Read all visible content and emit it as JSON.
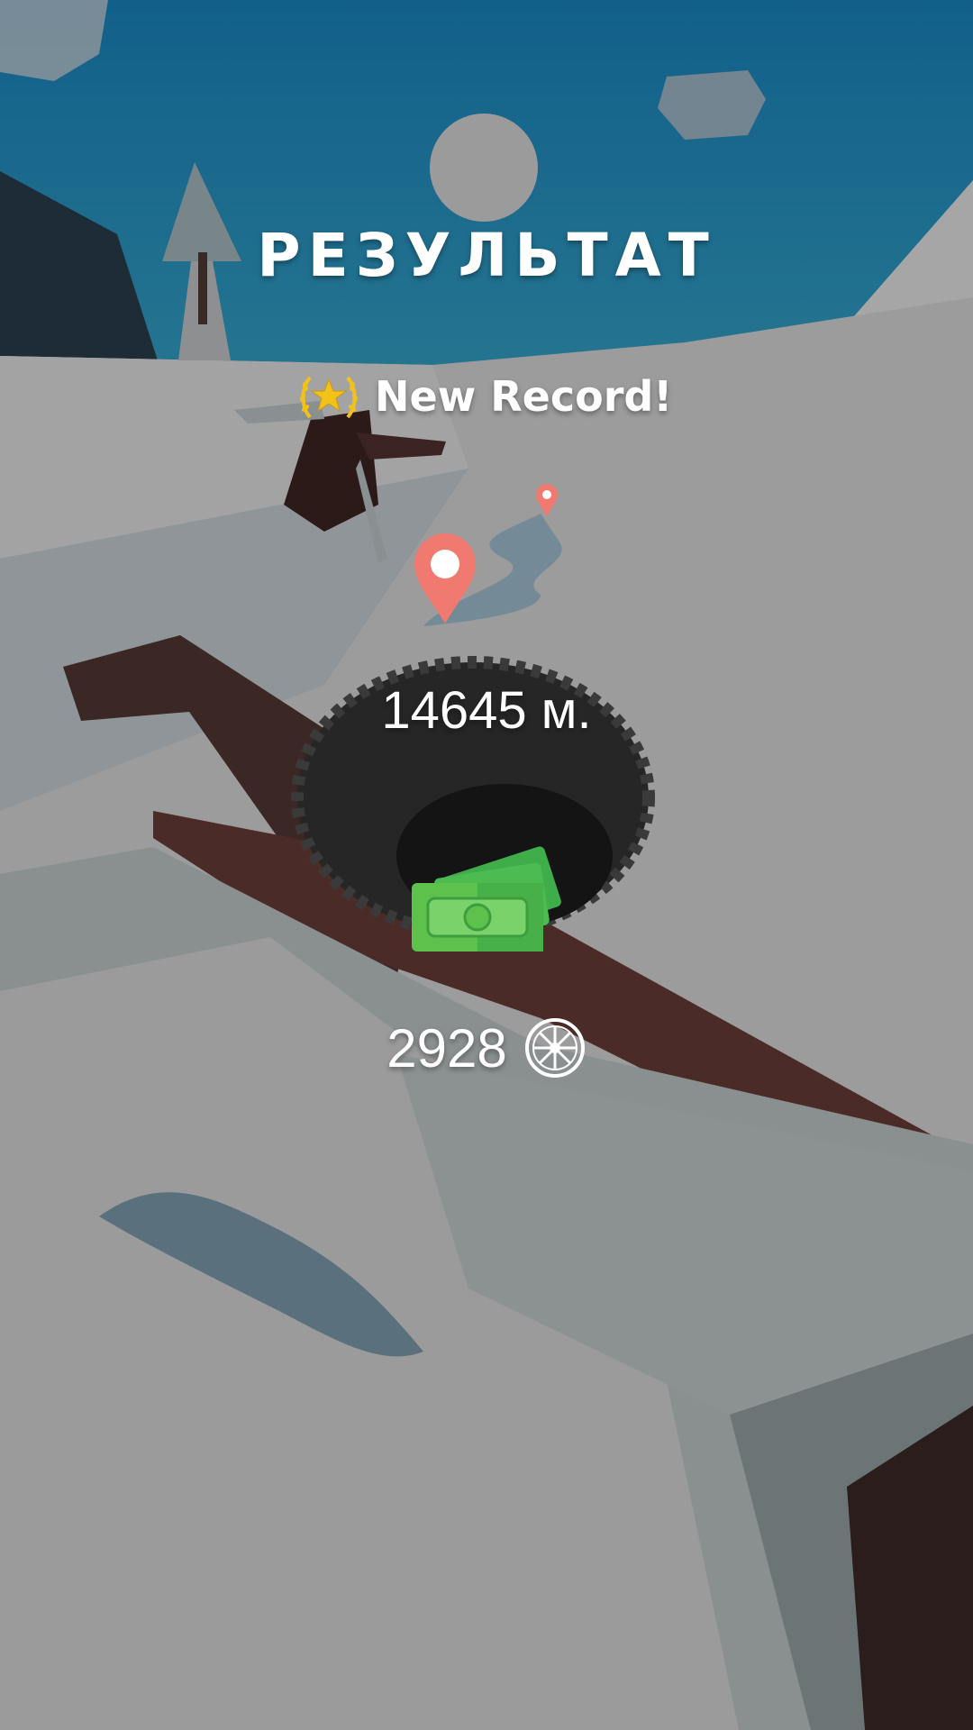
{
  "results": {
    "title": "РЕЗУЛЬТАТ",
    "record_label": "New Record!",
    "distance_value": "14645",
    "distance_unit": "м.",
    "coins_value": "2928"
  },
  "icons": {
    "record": "laurel-star-icon",
    "distance": "map-pin-icon",
    "reward": "cash-icon",
    "currency": "wheel-coin-icon"
  },
  "colors": {
    "sky": "#1c6a8c",
    "snow": "#9d9d9d",
    "pin": "#f07a70",
    "cash": "#5cc24c",
    "gold": "#f2c21b",
    "text": "#ffffff"
  }
}
